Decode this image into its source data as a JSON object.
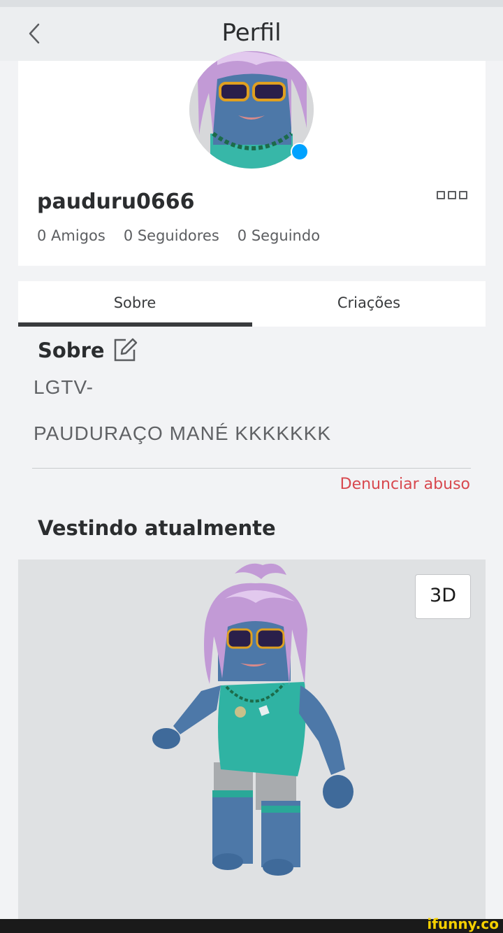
{
  "header": {
    "title": "Perfil"
  },
  "profile": {
    "username": "pauduru0666",
    "stats": {
      "friends": "0 Amigos",
      "followers": "0 Seguidores",
      "following": "0 Seguindo"
    },
    "online_color": "#00a2ff"
  },
  "tabs": [
    {
      "label": "Sobre",
      "active": true
    },
    {
      "label": "Criações",
      "active": false
    }
  ],
  "about": {
    "heading": "Sobre",
    "lines": [
      "LGTV-",
      "PAUDURAÇO MANÉ KKKKKKK"
    ],
    "report_link": "Denunciar abuso"
  },
  "wearing": {
    "heading": "Vestindo atualmente",
    "button_3d": "3D"
  },
  "watermark": "ifunny.co",
  "colors": {
    "report": "#d8484e",
    "tab_indicator": "#393b3d"
  }
}
